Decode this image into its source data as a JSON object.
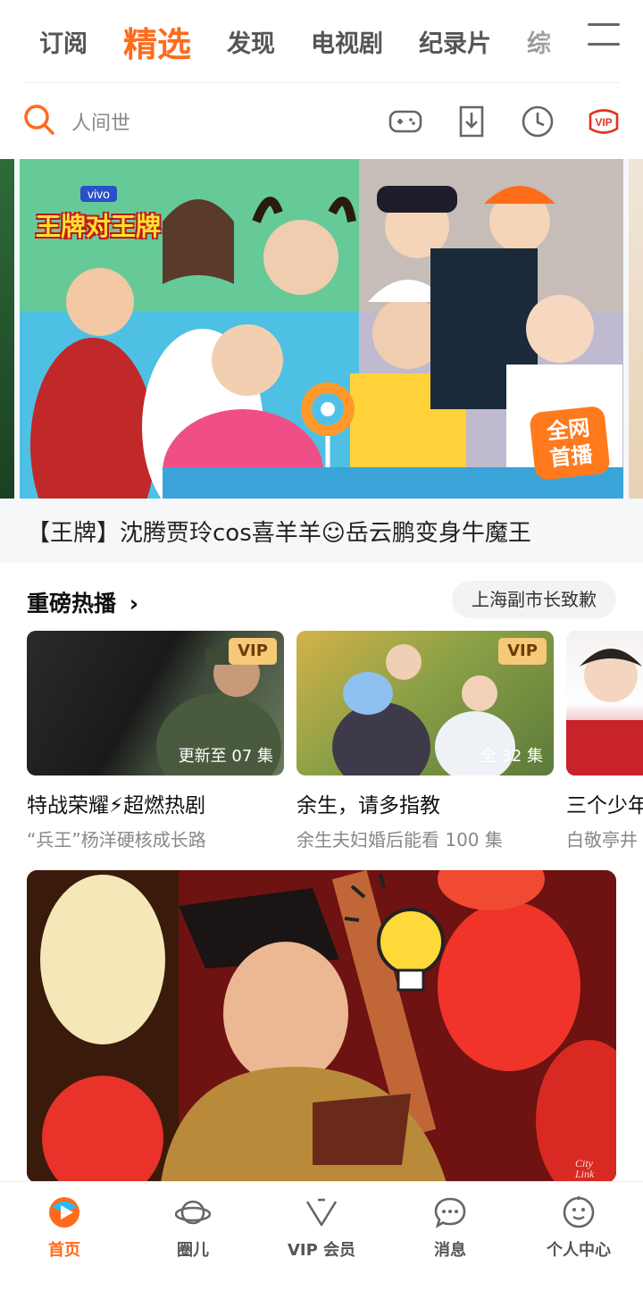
{
  "top_tabs": [
    {
      "label": "订阅"
    },
    {
      "label": "精选"
    },
    {
      "label": "发现"
    },
    {
      "label": "电视剧"
    },
    {
      "label": "纪录片"
    },
    {
      "label": "综"
    }
  ],
  "search": {
    "placeholder": "人间世"
  },
  "toolbar_icons": [
    "gamepad-icon",
    "download-icon",
    "history-icon",
    "vip-icon"
  ],
  "banner": {
    "show_logo": "王牌对王牌",
    "logo_sponsor": "vivo",
    "corner_badge": "全网首播",
    "caption": "【王牌】沈腾贾玲cos喜羊羊☺岳云鹏变身牛魔王"
  },
  "section": {
    "title": "重磅热播",
    "pill": "上海副市长致歉"
  },
  "cards": [
    {
      "title": "特战荣耀⚡超燃热剧",
      "subtitle": "“兵王”杨洋硬核成长路",
      "badge": "VIP",
      "episode": "更新至 07 集"
    },
    {
      "title": "余生，请多指教",
      "subtitle": "余生夫妇婚后能看 100 集",
      "badge": "VIP",
      "episode": "全 32 集"
    },
    {
      "title": "三个少年",
      "subtitle": "白敬亭井",
      "badge": "",
      "episode": ""
    }
  ],
  "feature": {
    "watermark": "City Link"
  },
  "bottom_nav": [
    {
      "label": "首页",
      "icon": "home-play-icon",
      "active": true
    },
    {
      "label": "圈儿",
      "icon": "planet-icon",
      "active": false
    },
    {
      "label": "VIP 会员",
      "icon": "vip-v-icon",
      "active": false
    },
    {
      "label": "消息",
      "icon": "message-icon",
      "active": false
    },
    {
      "label": "个人中心",
      "icon": "profile-icon",
      "active": false
    }
  ],
  "colors": {
    "accent": "#ff6a1c",
    "vip_gold": "#f5c978"
  }
}
